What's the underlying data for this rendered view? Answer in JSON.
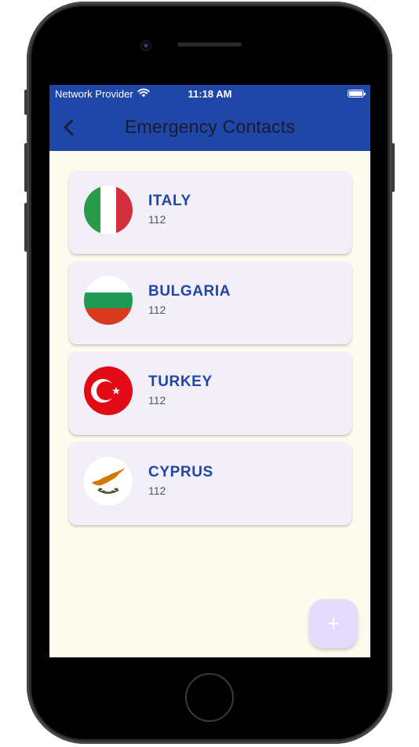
{
  "status_bar": {
    "carrier": "Network Provider",
    "time": "11:18 AM"
  },
  "app_bar": {
    "title": "Emergency Contacts",
    "back_icon": "chevron-left-icon"
  },
  "contacts": [
    {
      "country": "ITALY",
      "number": "112",
      "flag_icon": "italy-flag-icon"
    },
    {
      "country": "BULGARIA",
      "number": "112",
      "flag_icon": "bulgaria-flag-icon"
    },
    {
      "country": "TURKEY",
      "number": "112",
      "flag_icon": "turkey-flag-icon"
    },
    {
      "country": "CYPRUS",
      "number": "112",
      "flag_icon": "cyprus-flag-icon"
    }
  ],
  "fab": {
    "label": "+",
    "icon": "plus-icon"
  },
  "colors": {
    "primary": "#1e47a8",
    "background": "#fdfbee",
    "card": "#f3eff8",
    "fab": "#e4dcff"
  }
}
